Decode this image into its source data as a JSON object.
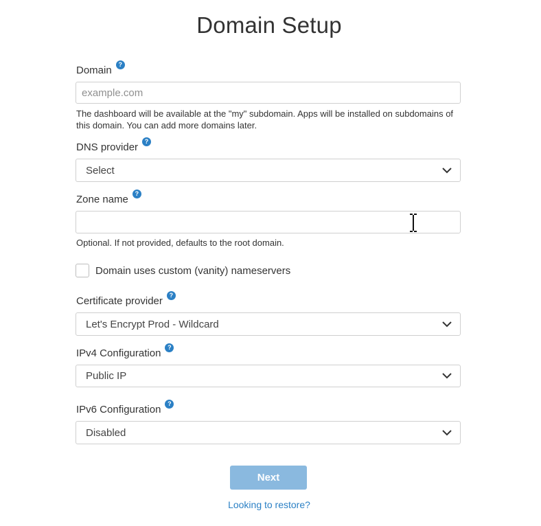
{
  "page_title": "Domain Setup",
  "domain": {
    "label": "Domain",
    "help": "?",
    "placeholder": "example.com",
    "hint": "The dashboard will be available at the \"my\" subdomain. Apps will be installed on subdomains of this domain. You can add more domains later."
  },
  "dns_provider": {
    "label": "DNS provider",
    "help": "?",
    "selected": "Select"
  },
  "zone_name": {
    "label": "Zone name",
    "help": "?",
    "value": "",
    "hint": "Optional. If not provided, defaults to the root domain."
  },
  "vanity_nameservers": {
    "label": "Domain uses custom (vanity) nameservers",
    "checked": false
  },
  "certificate_provider": {
    "label": "Certificate provider",
    "help": "?",
    "selected": "Let's Encrypt Prod - Wildcard"
  },
  "ipv4": {
    "label": "IPv4 Configuration",
    "help": "?",
    "selected": "Public IP"
  },
  "ipv6": {
    "label": "IPv6 Configuration",
    "help": "?",
    "selected": "Disabled"
  },
  "next_button": "Next",
  "restore_link": "Looking to restore?",
  "colors": {
    "accent": "#2b80c5",
    "button_disabled": "#8ab9df",
    "border": "#cfcfcf",
    "text": "#333333"
  },
  "icons": {
    "help": "question-circle-icon",
    "dropdown": "chevron-down-icon",
    "cursor": "text-cursor-icon"
  }
}
